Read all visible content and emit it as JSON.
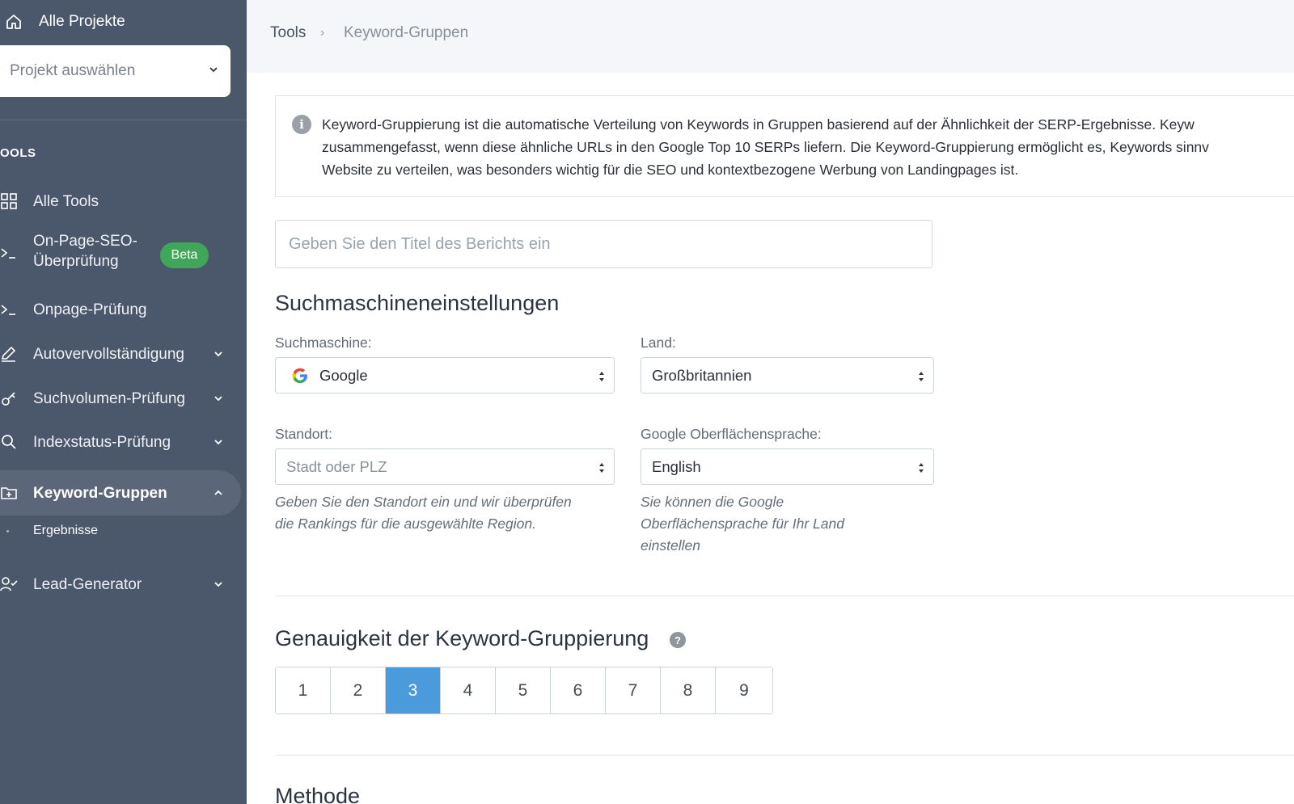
{
  "sidebar": {
    "all_projects": "Alle Projekte",
    "project_select": "Projekt auswählen",
    "section": "OOLS",
    "items": [
      {
        "label": "Alle Tools"
      },
      {
        "label_line1": "On-Page-SEO-",
        "label_line2": "Überprüfung",
        "badge": "Beta"
      },
      {
        "label": "Onpage-Prüfung"
      },
      {
        "label": "Autovervollständigung"
      },
      {
        "label": "Suchvolumen-Prüfung"
      },
      {
        "label": "Indexstatus-Prüfung"
      },
      {
        "label": "Keyword-Gruppen"
      },
      {
        "label": "Lead-Generator"
      }
    ],
    "sub_item": "Ergebnisse"
  },
  "header": {
    "crumb1": "Tools",
    "sep": "›",
    "crumb2": "Keyword-Gruppen"
  },
  "info": {
    "line1": "Keyword-Gruppierung ist die automatische Verteilung von Keywords in Gruppen basierend auf der Ähnlichkeit der SERP-Ergebnisse. Keyw",
    "line2": "zusammengefasst, wenn diese ähnliche URLs in den Google Top 10 SERPs liefern. Die Keyword-Gruppierung ermöglicht es, Keywords sinnv",
    "line3": "Website zu verteilen, was besonders wichtig für die SEO und kontextbezogene Werbung von Landingpages ist."
  },
  "report": {
    "placeholder": "Geben Sie den Titel des Berichts ein"
  },
  "search_settings": {
    "title": "Suchmaschineneinstellungen",
    "engine_label": "Suchmaschine:",
    "engine_value": "Google",
    "country_label": "Land:",
    "country_value": "Großbritannien",
    "location_label": "Standort:",
    "location_placeholder": "Stadt oder PLZ",
    "location_help_1": "Geben Sie den Standort ein und wir überprüfen",
    "location_help_2": "die Rankings für die ausgewählte Region.",
    "language_label": "Google Oberflächensprache:",
    "language_value": "English",
    "language_help_1": "Sie können die Google",
    "language_help_2": "Oberflächensprache für Ihr Land",
    "language_help_3": "einstellen"
  },
  "accuracy": {
    "title": "Genauigkeit der Keyword-Gruppierung",
    "help": "?",
    "options": [
      "1",
      "2",
      "3",
      "4",
      "5",
      "6",
      "7",
      "8",
      "9"
    ],
    "selected": "3"
  },
  "method": {
    "title": "Methode"
  },
  "colors": {
    "sidebar": "#4b576b",
    "active": "#4b9bdc",
    "badge": "#3fa65a"
  }
}
